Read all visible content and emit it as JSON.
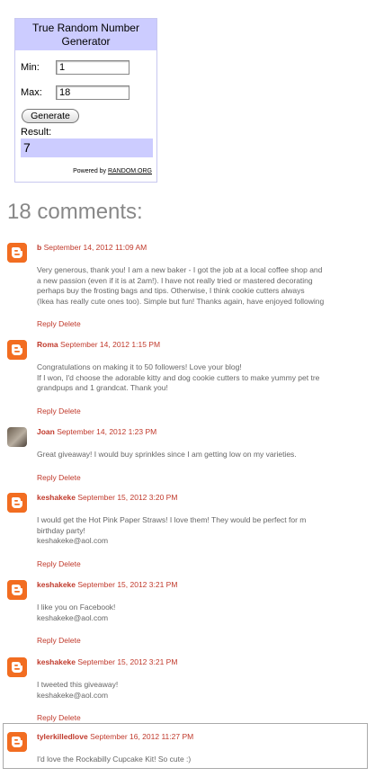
{
  "rng": {
    "title": "True Random Number Generator",
    "min_label": "Min:",
    "min_value": "1",
    "max_label": "Max:",
    "max_value": "18",
    "generate_label": "Generate",
    "result_label": "Result:",
    "result_value": "7",
    "powered_prefix": "Powered by",
    "powered_link": "RANDOM.ORG"
  },
  "comments_title": "18 comments:",
  "actions": {
    "reply": "Reply",
    "delete": "Delete"
  },
  "comments": [
    {
      "author": "b",
      "date": "September 14, 2012 11:09 AM",
      "avatar": "blogger-icon",
      "lines": [
        "Very generous, thank you! I am a new baker - I got the job at a local coffee shop and",
        "a new passion (even if it is at 2am!). I have not really tried or mastered decorating",
        "perhaps buy the frosting bags and tips. Otherwise, I think cookie cutters always",
        "(Ikea has really cute ones too). Simple but fun! Thanks again, have enjoyed following"
      ]
    },
    {
      "author": "Roma",
      "date": "September 14, 2012 1:15 PM",
      "avatar": "blogger-icon",
      "lines": [
        "Congratulations on making it to 50 followers! Love your blog!",
        "If I won, I'd choose the adorable kitty and dog cookie cutters to make yummy pet tre",
        "grandpups and 1 grandcat. Thank you!"
      ]
    },
    {
      "author": "Joan",
      "date": "September 14, 2012 1:23 PM",
      "avatar": "photo",
      "lines": [
        "Great giveaway! I would buy sprinkles since I am getting low on my varieties."
      ]
    },
    {
      "author": "keshakeke",
      "date": "September 15, 2012 3:20 PM",
      "avatar": "blogger-icon",
      "lines": [
        "I would get the Hot Pink Paper Straws! I love them! They would be perfect for m",
        "birthday party!",
        "keshakeke@aol.com"
      ]
    },
    {
      "author": "keshakeke",
      "date": "September 15, 2012 3:21 PM",
      "avatar": "blogger-icon",
      "lines": [
        "I like you on Facebook!",
        "keshakeke@aol.com"
      ]
    },
    {
      "author": "keshakeke",
      "date": "September 15, 2012 3:21 PM",
      "avatar": "blogger-icon",
      "lines": [
        "I tweeted this giveaway!",
        "keshakeke@aol.com"
      ]
    },
    {
      "author": "tylerkilledlove",
      "date": "September 16, 2012 11:27 PM",
      "avatar": "blogger-icon",
      "lines": [
        "I'd love the Rockabilly Cupcake Kit! So cute :)"
      ]
    }
  ],
  "colors": {
    "link": "#c0392b",
    "blogger_orange": "#f26d21",
    "rng_header": "#ccccff"
  }
}
